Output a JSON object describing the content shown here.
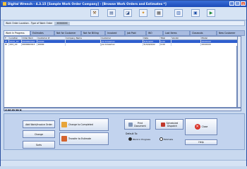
{
  "window": {
    "title": "Digital Wrench - 4.3.15 [Sample Work Order Company] - [Browse Work Orders and Estimates *]"
  },
  "filter": {
    "label": "Work Order Location - Type of Work Order",
    "value": "XXXXXXX"
  },
  "tabs": [
    {
      "label": "Work In Progress",
      "active": true
    },
    {
      "label": "Estimates"
    },
    {
      "label": "Not for Customer"
    },
    {
      "label": "Not for Billing"
    },
    {
      "label": "Invoiced"
    },
    {
      "label": "Job Paid"
    },
    {
      "label": "WO"
    },
    {
      "label": "Lost Items"
    },
    {
      "label": "Closeouts"
    },
    {
      "label": "New Customer"
    }
  ],
  "table": {
    "columns": [
      "T",
      "Location",
      "Order Num",
      "Customer #",
      "Company Name",
      "Customer",
      "Date",
      "Total",
      "Vendor",
      "Model"
    ],
    "rows": [
      {
        "selected": true,
        "cells": [
          "W",
          "XXXX_XX",
          "0000002010",
          "10000",
          "",
          "Joe Grossman",
          "3/21/4/03",
          "0.00",
          "",
          "XXXXXXX"
        ]
      },
      {
        "selected": false,
        "cells": [
          "W",
          "XXX_XX",
          "0000002013",
          "10000",
          "",
          "Joe Grossman",
          "5/24/4/0/02",
          "0.00",
          "",
          "XXXXXXX"
        ]
      }
    ]
  },
  "buttons": {
    "add_wo": "Add Work/Invoice Order",
    "change": "Change",
    "sorts": "Sorts",
    "change_completed": "Change to Completed",
    "transfer_estimate": "Transfer to Estimate",
    "print_document": "Print\nDocument",
    "scheduled_dispatch": "Scheduled\nDispatch",
    "close": "Close",
    "help": "Help"
  },
  "default_to": {
    "label": "Default To:",
    "options": [
      {
        "label": "Work in Progress",
        "selected": true
      },
      {
        "label": "Estimate",
        "selected": false
      }
    ]
  },
  "colors": {
    "selected_row": "#2f5fcf",
    "title_bar": "#1c4bb8",
    "tab_active": "#f3f6fb",
    "tab_inactive": "#a9bce0"
  }
}
